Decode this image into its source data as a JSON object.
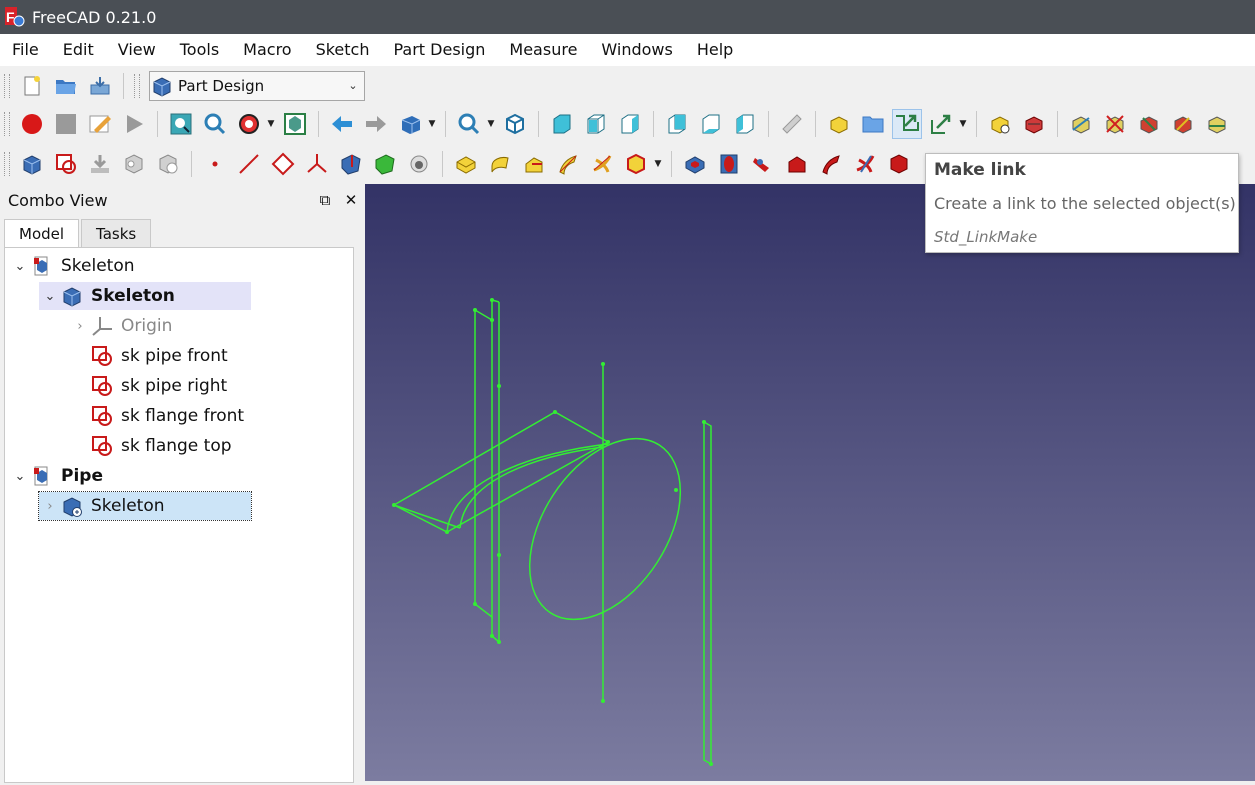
{
  "window": {
    "title": "FreeCAD 0.21.0"
  },
  "menu": [
    "File",
    "Edit",
    "View",
    "Tools",
    "Macro",
    "Sketch",
    "Part Design",
    "Measure",
    "Windows",
    "Help"
  ],
  "workbench_selector": {
    "value": "Part Design"
  },
  "combo_view": {
    "title": "Combo View",
    "tabs": [
      "Model",
      "Tasks"
    ],
    "tree": [
      {
        "label": "Skeleton"
      },
      {
        "label": "Skeleton"
      },
      {
        "label": "Origin"
      },
      {
        "label": "sk pipe front"
      },
      {
        "label": "sk pipe right"
      },
      {
        "label": "sk flange front"
      },
      {
        "label": "sk flange top"
      },
      {
        "label": "Pipe"
      },
      {
        "label": "Skeleton"
      }
    ]
  },
  "tooltip": {
    "title": "Make link",
    "description": "Create a link to the selected object(s)",
    "command": "Std_LinkMake"
  },
  "colors": {
    "wireframe": "#33ee33",
    "sketch_red": "#cc1111",
    "body_blue": "#3a6db5",
    "viewport_top": "#333366",
    "viewport_bottom": "#7c7ca0"
  }
}
